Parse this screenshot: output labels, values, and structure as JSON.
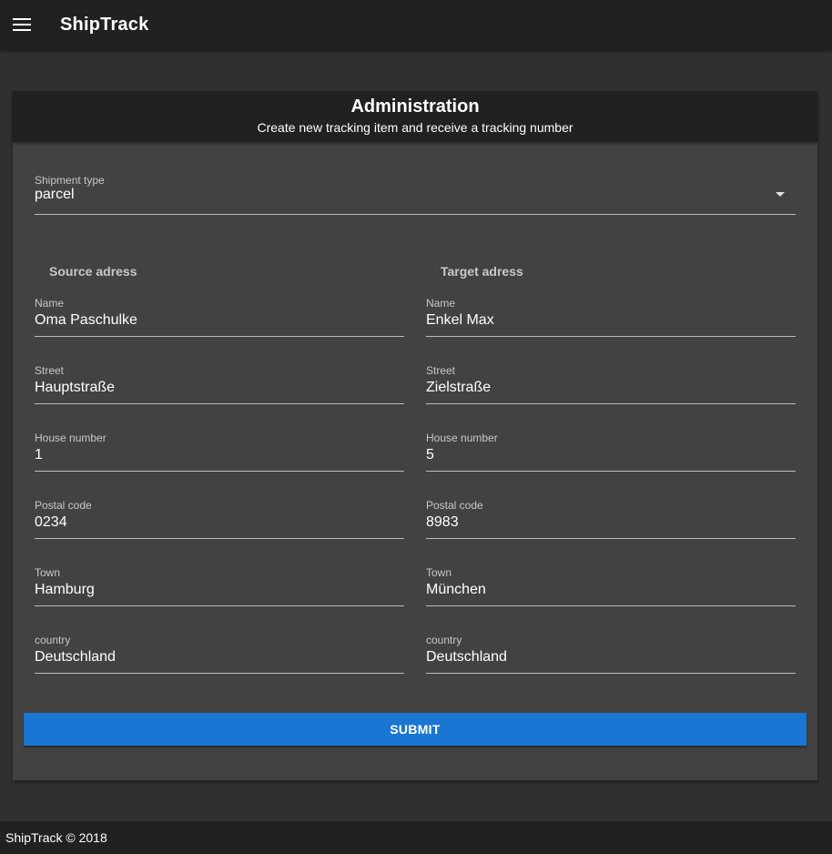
{
  "app": {
    "title": "ShipTrack"
  },
  "card": {
    "title": "Administration",
    "subtitle": "Create new tracking item and receive a tracking number"
  },
  "shipment_type": {
    "label": "Shipment type",
    "value": "parcel"
  },
  "source": {
    "heading": "Source adress",
    "fields": [
      {
        "label": "Name",
        "value": "Oma Paschulke"
      },
      {
        "label": "Street",
        "value": "Hauptstraße"
      },
      {
        "label": "House number",
        "value": "1"
      },
      {
        "label": "Postal code",
        "value": "0234"
      },
      {
        "label": "Town",
        "value": "Hamburg"
      },
      {
        "label": "country",
        "value": "Deutschland"
      }
    ]
  },
  "target": {
    "heading": "Target adress",
    "fields": [
      {
        "label": "Name",
        "value": "Enkel Max"
      },
      {
        "label": "Street",
        "value": "Zielstraße"
      },
      {
        "label": "House number",
        "value": "5"
      },
      {
        "label": "Postal code",
        "value": "8983"
      },
      {
        "label": "Town",
        "value": "München"
      },
      {
        "label": "country",
        "value": "Deutschland"
      }
    ]
  },
  "submit_label": "SUBMIT",
  "footer": {
    "text": "ShipTrack © 2018"
  },
  "colors": {
    "primary": "#1976d2",
    "appbar": "#212121",
    "card": "#424242",
    "background": "#303030"
  }
}
